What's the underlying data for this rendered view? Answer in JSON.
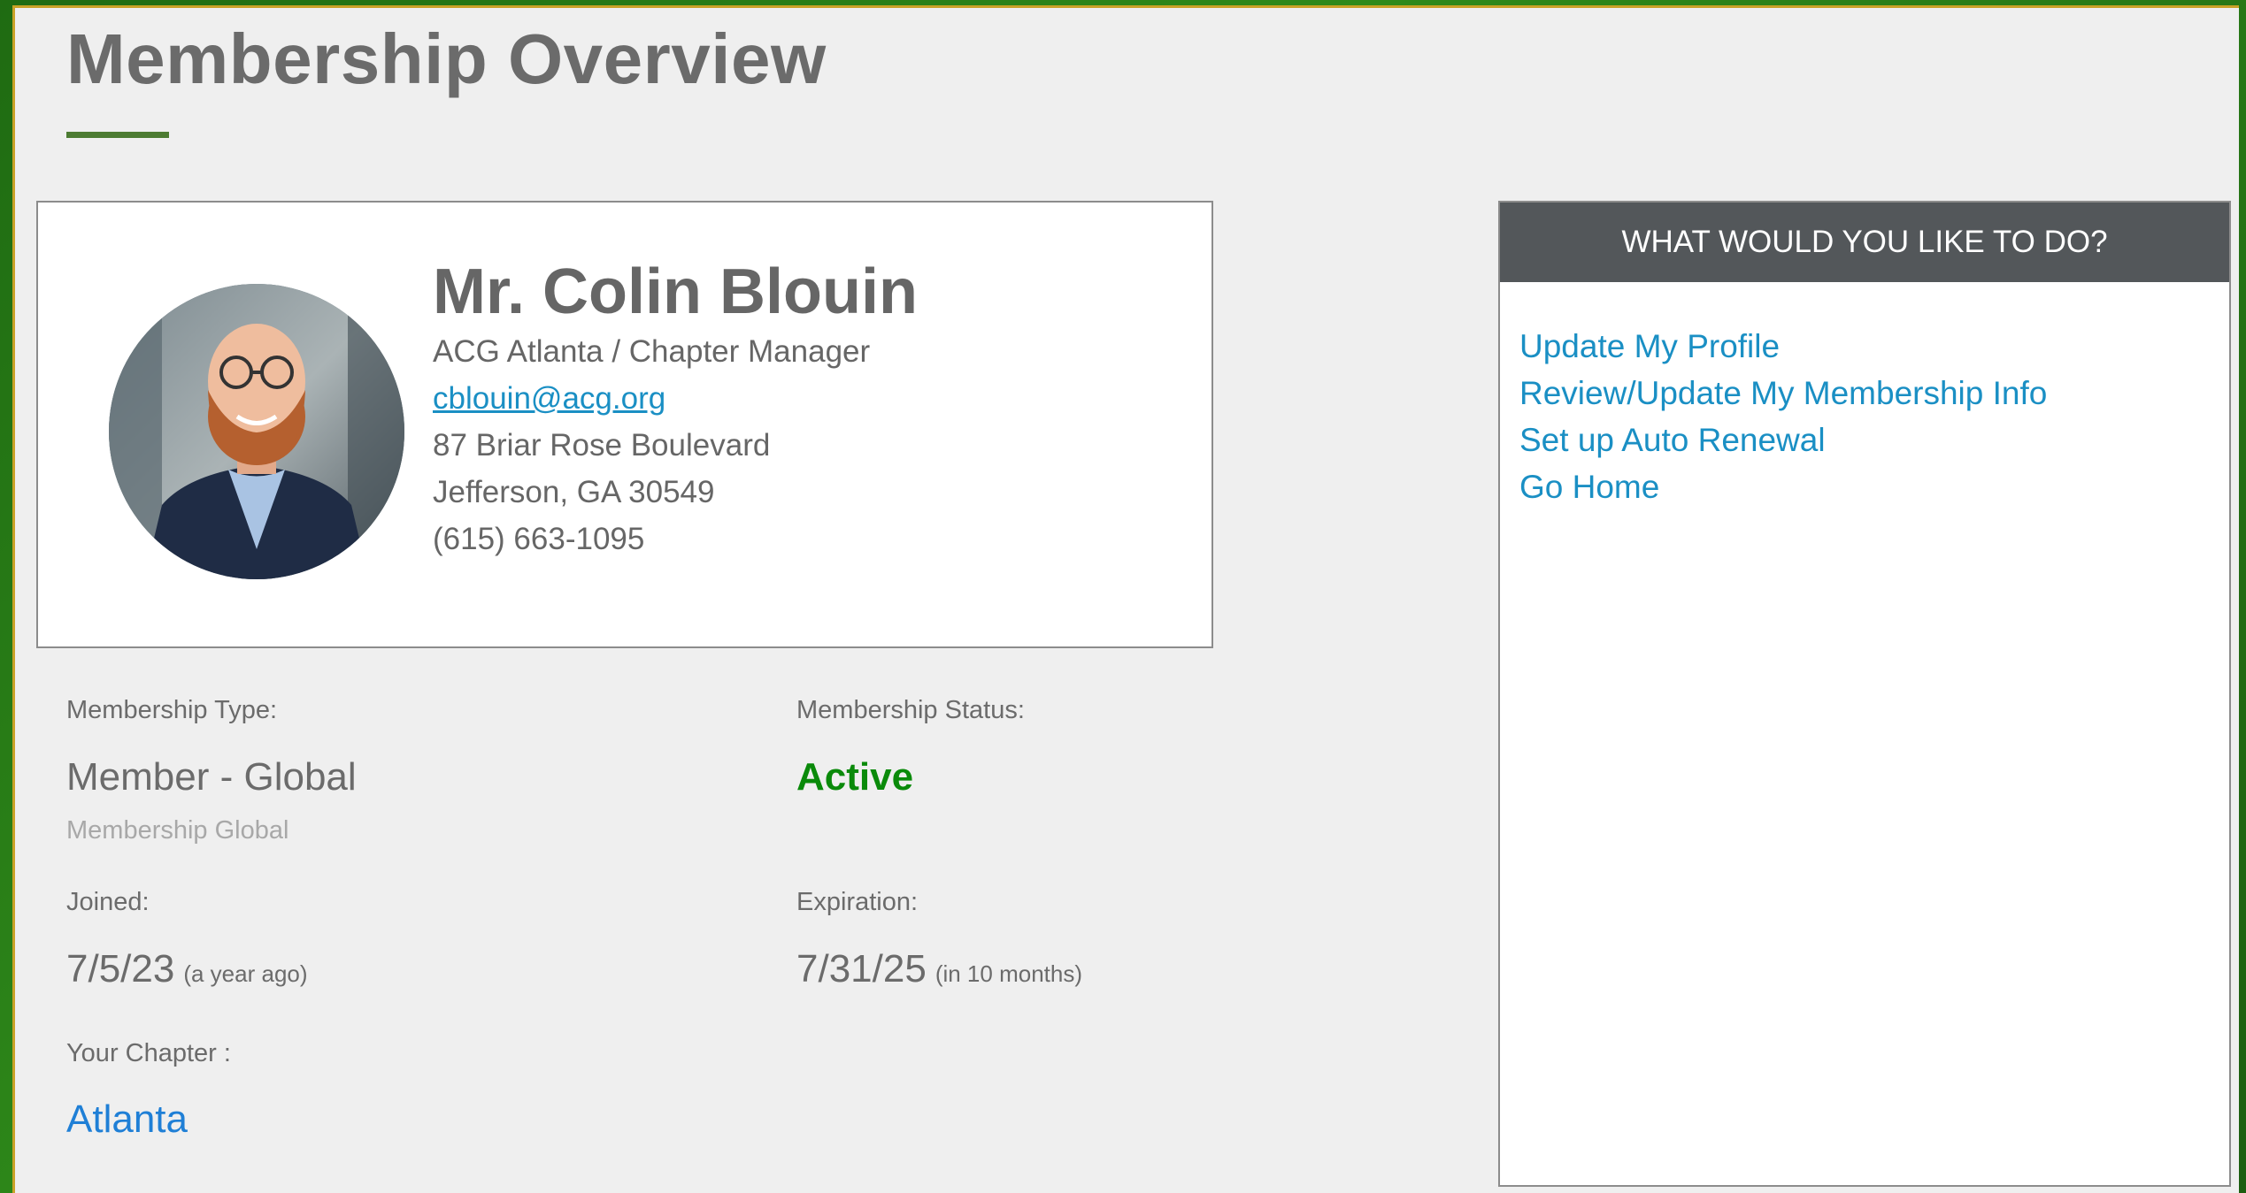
{
  "page": {
    "title": "Membership Overview",
    "accent_color": "#4c7b32"
  },
  "profile": {
    "name": "Mr. Colin Blouin",
    "organization_role": "ACG Atlanta / Chapter Manager",
    "email": "cblouin@acg.org",
    "address_line1": "87 Briar Rose Boulevard",
    "address_line2": "Jefferson, GA 30549",
    "phone": "(615) 663-1095",
    "avatar_icon": "person-photo"
  },
  "membership": {
    "type_label": "Membership Type:",
    "type_value": "Member - Global",
    "type_sub": "Membership Global",
    "status_label": "Membership Status:",
    "status_value": "Active",
    "status_color": "#0a8a0a",
    "joined_label": "Joined:",
    "joined_value": "7/5/23",
    "joined_note": "(a year ago)",
    "expiration_label": "Expiration:",
    "expiration_value": "7/31/25",
    "expiration_note": "(in 10 months)",
    "chapter_label": "Your Chapter :",
    "chapter_value": "Atlanta"
  },
  "actions": {
    "header": "WHAT WOULD YOU LIKE TO DO?",
    "links": [
      {
        "label": "Update My Profile"
      },
      {
        "label": "Review/Update My Membership Info"
      },
      {
        "label": "Set up Auto Renewal"
      },
      {
        "label": "Go Home"
      }
    ]
  }
}
